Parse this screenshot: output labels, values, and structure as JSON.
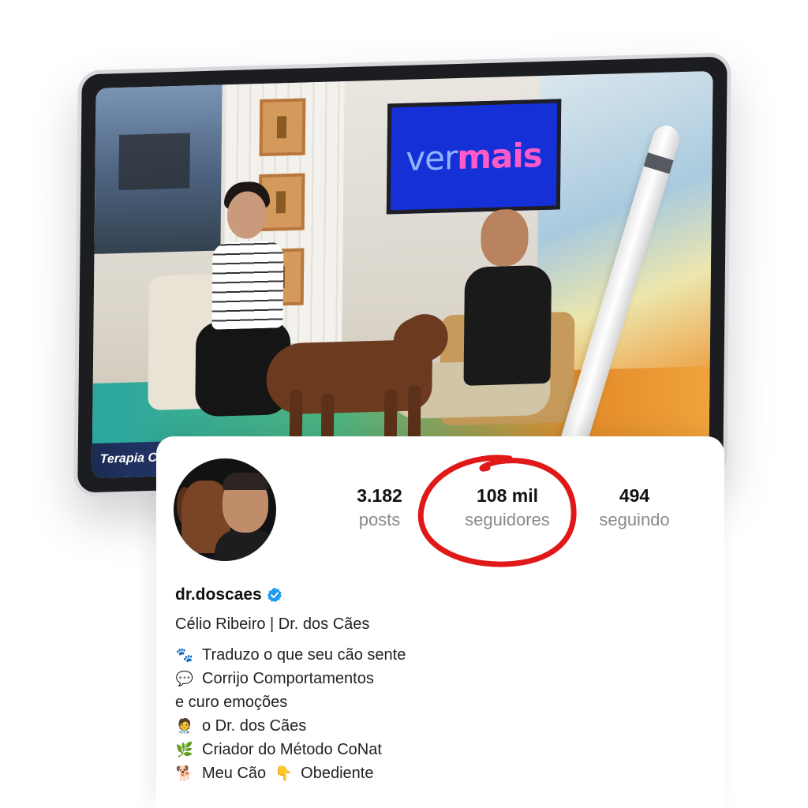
{
  "tv_screen": {
    "studio_tv_text_a": "ver",
    "studio_tv_text_b": "mais",
    "lower_third": "Terapia Ca"
  },
  "profile": {
    "stats": [
      {
        "value": "3.182",
        "label": "posts"
      },
      {
        "value": "108 mil",
        "label": "seguidores"
      },
      {
        "value": "494",
        "label": "seguindo"
      }
    ],
    "username": "dr.doscaes",
    "verified_icon": "verified-badge-icon",
    "full_name": "Célio Ribeiro | Dr. dos Cães",
    "bio": [
      {
        "icon": "paw-prints-icon",
        "glyph": "🐾",
        "text": "Traduzo o que seu cão sente"
      },
      {
        "icon": "speech-bubble-icon",
        "glyph": "💬",
        "text": "Corrijo Comportamentos"
      },
      {
        "icon": "",
        "glyph": "",
        "text": "e curo emoções"
      },
      {
        "icon": "doctor-icon",
        "glyph": "🧑‍⚕️",
        "text": "o Dr. dos Cães"
      },
      {
        "icon": "herb-icon",
        "glyph": "🌿",
        "text": "Criador do Método CoNat"
      },
      {
        "icon": "dog-icon",
        "glyph": "🐕",
        "text": "Meu Cão"
      },
      {
        "icon": "pointing-down-icon",
        "glyph": "👇",
        "text": "Obediente"
      }
    ]
  },
  "colors": {
    "annotation_circle": "#e01818",
    "verified": "#1d9bf0",
    "stat_label": "#8a8a8a"
  }
}
